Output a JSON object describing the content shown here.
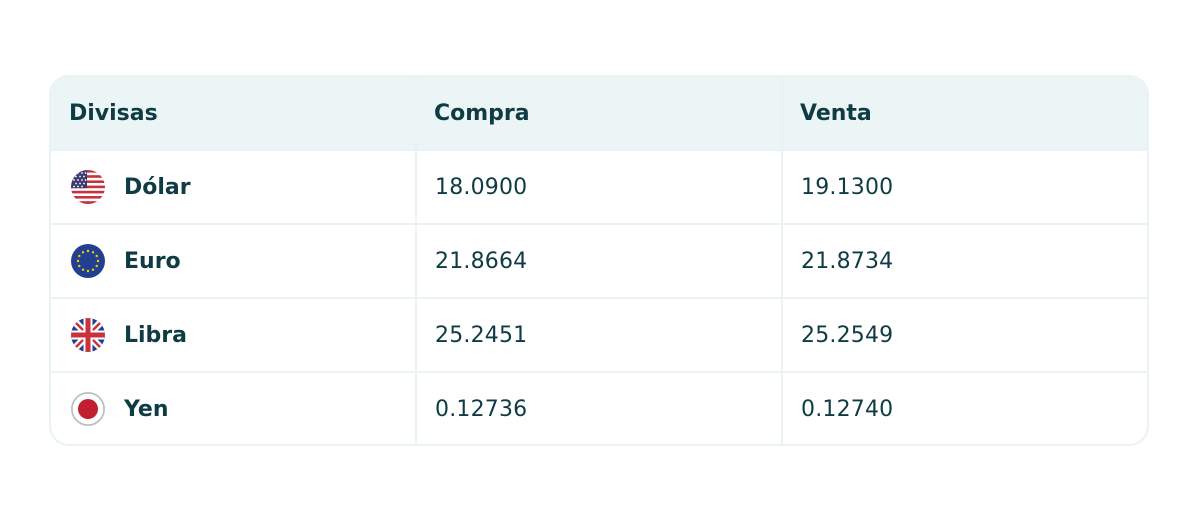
{
  "table": {
    "headers": [
      "Divisas",
      "Compra",
      "Venta"
    ],
    "rows": [
      {
        "currency": "Dólar",
        "flag_icon": "us-flag-icon",
        "compra": "18.0900",
        "venta": "19.1300"
      },
      {
        "currency": "Euro",
        "flag_icon": "eu-flag-icon",
        "compra": "21.8664",
        "venta": "21.8734"
      },
      {
        "currency": "Libra",
        "flag_icon": "uk-flag-icon",
        "compra": "25.2451",
        "venta": "25.2549"
      },
      {
        "currency": "Yen",
        "flag_icon": "japan-flag-icon",
        "compra": "0.12736",
        "venta": "0.12740"
      }
    ]
  },
  "colors": {
    "text": "#0f3b44",
    "header_bg": "#ecf5f6",
    "border": "#e9f3f4",
    "row_bg": "#ffffff"
  }
}
